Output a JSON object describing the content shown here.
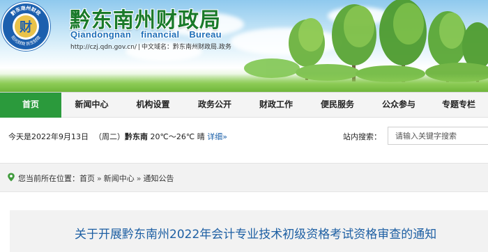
{
  "header": {
    "logo": {
      "ring_top_text": "黔东南州财政",
      "ring_bottom_text": "阳光财政  民生财政",
      "center_glyph": "财"
    },
    "title": "黔东南州财政局",
    "subtitle": "Qiandongnan financial Bureau",
    "url": "http://czj.qdn.gov.cn/",
    "separator": "|",
    "chinese_domain": "中文域名：黔东南州财政局.政务"
  },
  "nav": {
    "items": [
      {
        "label": "首页",
        "active": true
      },
      {
        "label": "新闻中心",
        "active": false
      },
      {
        "label": "机构设置",
        "active": false
      },
      {
        "label": "政务公开",
        "active": false
      },
      {
        "label": "财政工作",
        "active": false
      },
      {
        "label": "便民服务",
        "active": false
      },
      {
        "label": "公众参与",
        "active": false
      },
      {
        "label": "专题专栏",
        "active": false
      }
    ],
    "active_color": "#2b9a3c"
  },
  "info_bar": {
    "date": "今天是2022年9月13日",
    "weekday": "（周二）",
    "weather_city": "黔东南",
    "weather_temp": "20℃～26℃ 晴",
    "weather_detail": "详细»",
    "search_label": "站内搜索：",
    "search_placeholder": "请输入关键字搜索"
  },
  "breadcrumb": {
    "prefix": "您当前所在位置：",
    "items": [
      "首页",
      "新闻中心",
      "通知公告"
    ],
    "separator": "»"
  },
  "article": {
    "title": "关于开展黔东南州2022年会计专业技术初级资格考试资格审查的通知",
    "title_color": "#1d5fa3"
  }
}
